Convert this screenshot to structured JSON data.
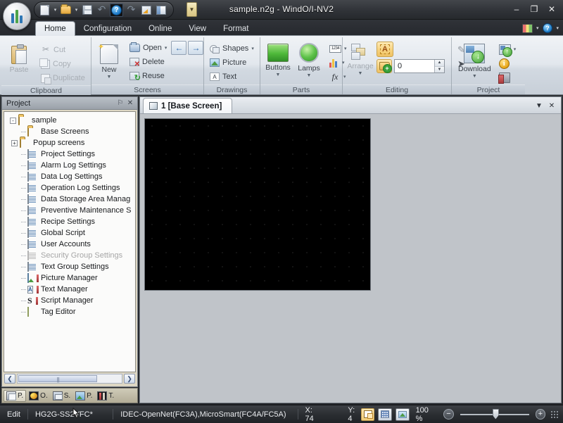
{
  "window": {
    "title": "sample.n2g - WindO/I-NV2",
    "minimize_label": "–",
    "maximize_label": "❐",
    "close_label": "✕"
  },
  "quick_access": {
    "items": [
      {
        "name": "new",
        "icon": "new-document-icon",
        "has_arrow": true
      },
      {
        "name": "open",
        "icon": "open-folder-icon",
        "has_arrow": true
      },
      {
        "name": "save",
        "icon": "save-icon",
        "has_arrow": false
      },
      {
        "name": "undo",
        "icon": "undo-icon",
        "has_arrow": false,
        "glyph": "↶"
      },
      {
        "name": "help",
        "icon": "help-icon",
        "has_arrow": false,
        "glyph": "?",
        "selected": true
      },
      {
        "name": "redo",
        "icon": "redo-icon",
        "has_arrow": false,
        "glyph": "↷"
      },
      {
        "name": "properties",
        "icon": "properties-sheet-icon",
        "has_arrow": false
      },
      {
        "name": "window",
        "icon": "window-icon",
        "has_arrow": false
      }
    ],
    "overflow_label": "▼"
  },
  "ribbon": {
    "tabs": [
      {
        "label": "Home",
        "active": true
      },
      {
        "label": "Configuration",
        "active": false
      },
      {
        "label": "Online",
        "active": false
      },
      {
        "label": "View",
        "active": false
      },
      {
        "label": "Format",
        "active": false
      }
    ],
    "tab_right_icons": [
      {
        "name": "library-icon",
        "arrow": "⌄"
      },
      {
        "name": "help-circle-icon",
        "arrow": "⌄"
      }
    ],
    "groups": [
      {
        "name": "clipboard",
        "title": "Clipboard",
        "big": {
          "label": "Paste",
          "icon": "paste-icon",
          "disabled": true
        },
        "small": [
          {
            "label": "Cut",
            "icon": "cut-icon",
            "disabled": true
          },
          {
            "label": "Copy",
            "icon": "copy-icon",
            "disabled": true
          },
          {
            "label": "Duplicate",
            "icon": "duplicate-icon",
            "disabled": true
          }
        ]
      },
      {
        "name": "screens",
        "title": "Screens",
        "big": {
          "label": "New",
          "icon": "new-screen-icon",
          "arrow": "▼"
        },
        "small": [
          {
            "label": "Open",
            "icon": "open-screen-icon",
            "arrow": "▾"
          },
          {
            "label": "Delete",
            "icon": "delete-screen-icon"
          },
          {
            "label": "Reuse",
            "icon": "reuse-screen-icon"
          }
        ],
        "nav": [
          {
            "name": "previous-screen-button",
            "glyph": "←"
          },
          {
            "name": "next-screen-button",
            "glyph": "→"
          }
        ]
      },
      {
        "name": "drawings",
        "title": "Drawings",
        "small": [
          {
            "label": "Shapes",
            "icon": "shapes-icon",
            "arrow": "▾"
          },
          {
            "label": "Picture",
            "icon": "picture-icon"
          },
          {
            "label": "Text",
            "icon": "text-icon"
          }
        ]
      },
      {
        "name": "parts",
        "title": "Parts",
        "big_items": [
          {
            "label": "Buttons",
            "icon": "button-part-icon",
            "arrow": "▼"
          },
          {
            "label": "Lamps",
            "icon": "lamp-part-icon",
            "arrow": "▼"
          }
        ],
        "small_icons": [
          {
            "name": "data-display-icon",
            "label": "1234",
            "arrow": "▾"
          },
          {
            "name": "chart-part-icon",
            "arrow": "▾"
          },
          {
            "name": "function-part-icon",
            "label": "fx",
            "arrow": "▾"
          }
        ]
      },
      {
        "name": "editing",
        "title": "Editing",
        "big": {
          "label": "Arrange",
          "icon": "arrange-icon",
          "arrow": "▼",
          "disabled": true
        },
        "toggles": [
          {
            "name": "text-edit-toggle",
            "icon": "text-A-icon",
            "active": true
          }
        ],
        "stepper": {
          "name": "layer-stepper",
          "icon": "add-group-icon",
          "value": "0"
        },
        "tools": [
          {
            "name": "pen-tool-icon",
            "glyph": "✎",
            "disabled": true
          },
          {
            "name": "select-cursor-icon",
            "glyph": "➤"
          }
        ]
      },
      {
        "name": "project",
        "title": "Project",
        "big": {
          "label": "Download",
          "icon": "download-icon",
          "arrow": "▼"
        },
        "small_icons": [
          {
            "name": "upload-icon",
            "arrow": "▾"
          },
          {
            "name": "project-info-icon",
            "label": "i"
          },
          {
            "name": "project-tools-icon"
          }
        ]
      }
    ]
  },
  "project_panel": {
    "title": "Project",
    "pin_label": "⚐",
    "close_label": "✕",
    "tree": [
      {
        "label": "sample",
        "icon": "folder-icon",
        "indent": 0,
        "expander": "-"
      },
      {
        "label": "Base Screens",
        "icon": "folder-icon",
        "indent": 1,
        "expander": ""
      },
      {
        "label": "Popup screens",
        "icon": "folder-icon",
        "indent": 1,
        "expander": "+"
      },
      {
        "label": "Project Settings",
        "icon": "document-icon",
        "indent": 1,
        "expander": ""
      },
      {
        "label": "Alarm Log Settings",
        "icon": "document-icon",
        "indent": 1,
        "expander": ""
      },
      {
        "label": "Data Log Settings",
        "icon": "document-icon",
        "indent": 1,
        "expander": ""
      },
      {
        "label": "Operation Log Settings",
        "icon": "document-icon",
        "indent": 1,
        "expander": ""
      },
      {
        "label": "Data Storage Area Manag",
        "icon": "document-icon",
        "indent": 1,
        "expander": ""
      },
      {
        "label": "Preventive Maintenance S",
        "icon": "document-icon",
        "indent": 1,
        "expander": ""
      },
      {
        "label": "Recipe Settings",
        "icon": "document-icon",
        "indent": 1,
        "expander": ""
      },
      {
        "label": "Global Script",
        "icon": "document-icon",
        "indent": 1,
        "expander": ""
      },
      {
        "label": "User Accounts",
        "icon": "document-icon",
        "indent": 1,
        "expander": ""
      },
      {
        "label": "Security Group Settings",
        "icon": "document-icon",
        "indent": 1,
        "expander": "",
        "disabled": true
      },
      {
        "label": "Text Group Settings",
        "icon": "document-icon",
        "indent": 1,
        "expander": ""
      },
      {
        "label": "Picture Manager",
        "icon": "picture-manager-icon",
        "indent": 1,
        "expander": ""
      },
      {
        "label": "Text Manager",
        "icon": "text-manager-icon",
        "indent": 1,
        "expander": ""
      },
      {
        "label": "Script Manager",
        "icon": "script-manager-icon",
        "indent": 1,
        "expander": ""
      },
      {
        "label": "Tag Editor",
        "icon": "tag-editor-icon",
        "indent": 1,
        "expander": ""
      }
    ],
    "scroll": {
      "left_label": "❮",
      "right_label": "❯"
    },
    "tabs": [
      {
        "label": "P.",
        "icon": "project-panel-icon",
        "active": true
      },
      {
        "label": "O.",
        "icon": "object-panel-icon",
        "active": false
      },
      {
        "label": "S.",
        "icon": "screen-panel-icon",
        "active": false
      },
      {
        "label": "P.",
        "icon": "picture-panel-icon",
        "active": false
      },
      {
        "label": "T.",
        "icon": "tools-panel-icon",
        "active": false
      }
    ]
  },
  "document": {
    "tab": {
      "label": "1  [Base Screen]",
      "icon": "base-screen-icon"
    },
    "menu_label": "▼",
    "close_label": "✕"
  },
  "status_bar": {
    "mode": "Edit",
    "model": "HG2G-SS2VFC*",
    "protocol": "IDEC-OpenNet(FC3A),MicroSmart(FC4A/FC5A)",
    "coord_x": "X: 74",
    "coord_y": "Y: 4",
    "view_buttons": [
      {
        "name": "screen-frame-toggle",
        "active": true
      },
      {
        "name": "grid-toggle",
        "active": false
      },
      {
        "name": "background-image-toggle",
        "active": false
      }
    ],
    "zoom_level": "100 %",
    "zoom_out_label": "−",
    "zoom_in_label": "+"
  }
}
